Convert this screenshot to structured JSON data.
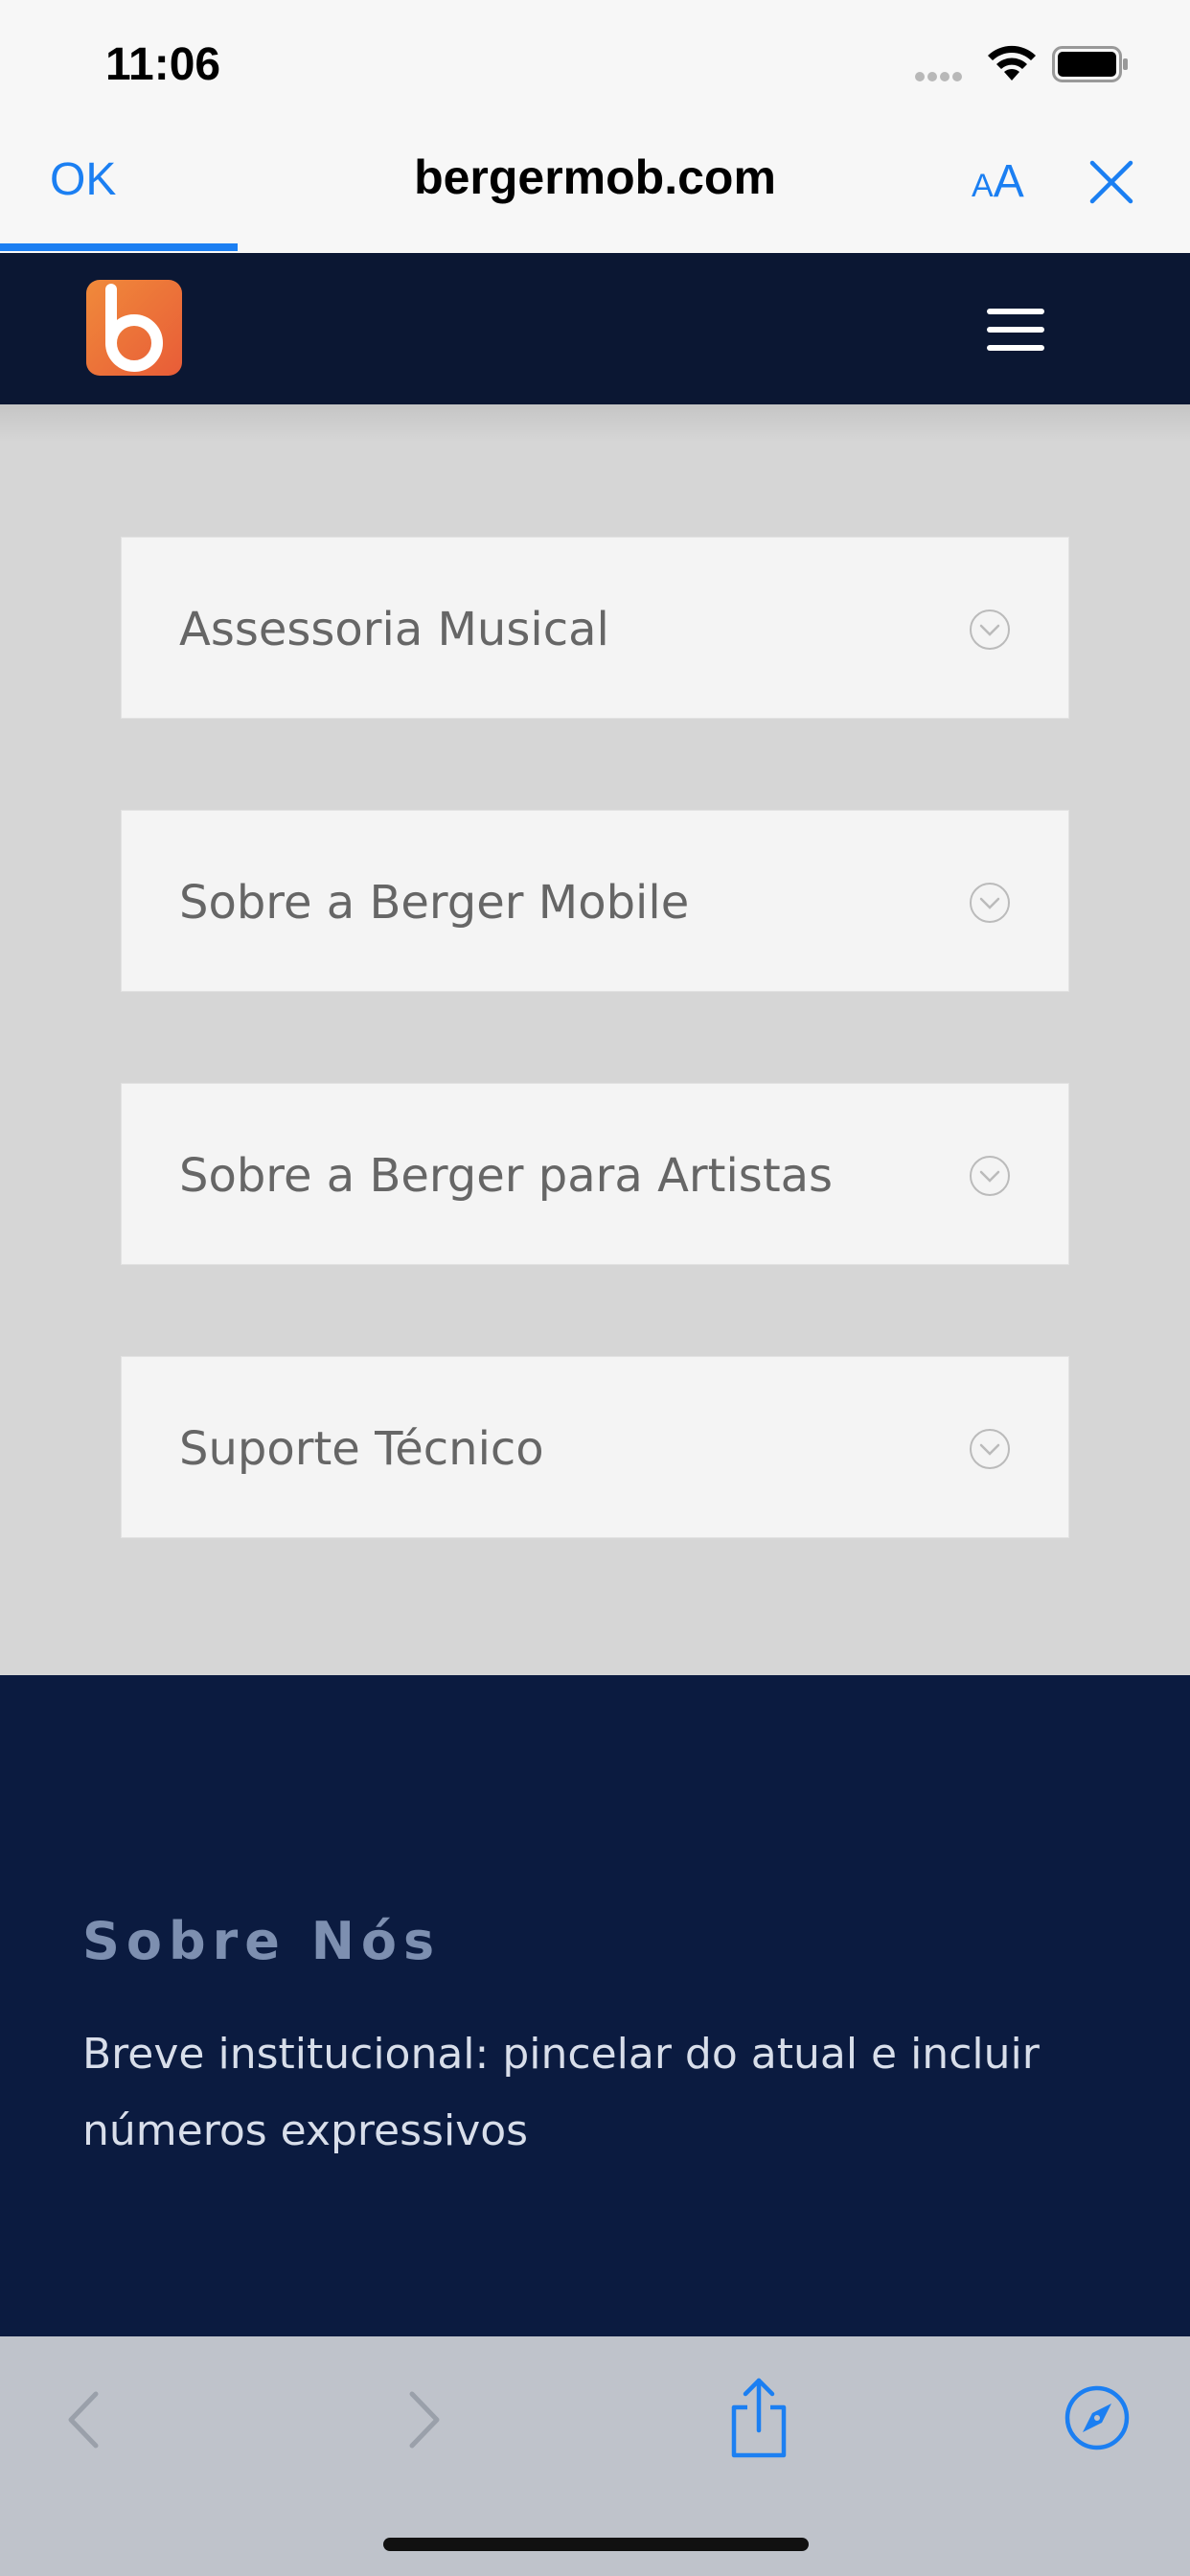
{
  "status_bar": {
    "time": "11:06"
  },
  "browser": {
    "done_label": "OK",
    "domain": "bergermob.com",
    "text_size_small": "A",
    "text_size_large": "A",
    "load_progress_fraction": 0.2
  },
  "accordion": {
    "items": [
      {
        "label": "Assessoria Musical"
      },
      {
        "label": "Sobre a Berger Mobile"
      },
      {
        "label": "Sobre a Berger para Artistas"
      },
      {
        "label": "Suporte Técnico"
      }
    ]
  },
  "footer": {
    "title": "Sobre Nós",
    "text": "Breve institucional: pincelar do atual e incluir números expressivos"
  },
  "colors": {
    "accent": "#1b7ff2",
    "nav_bg": "#0b1733",
    "footer_bg": "#0b1b40",
    "logo_gradient_start": "#f08a3a",
    "logo_gradient_end": "#e85c38"
  },
  "icons": {
    "logo": "berger-b-logo",
    "menu": "hamburger-icon",
    "accordion": "chevron-down-circle-icon",
    "toolbar": [
      "back-arrow-icon",
      "forward-arrow-icon",
      "share-icon",
      "compass-icon"
    ]
  }
}
